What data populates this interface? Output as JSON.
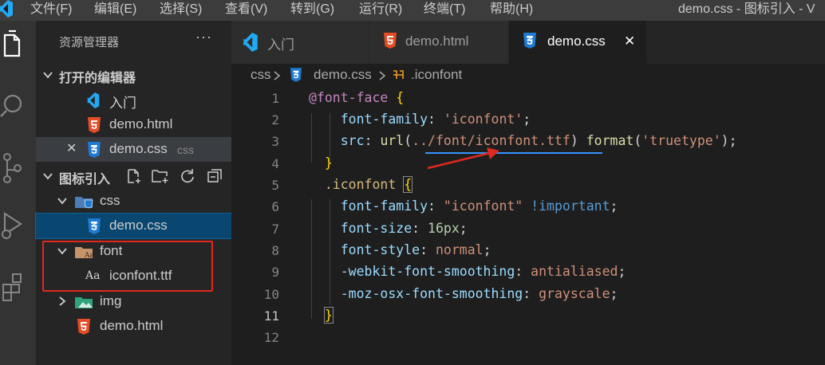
{
  "menubar": {
    "items": [
      "文件(F)",
      "编辑(E)",
      "选择(S)",
      "查看(V)",
      "转到(G)",
      "运行(R)",
      "终端(T)",
      "帮助(H)"
    ],
    "title": "demo.css - 图标引入 - V"
  },
  "sidebar": {
    "title": "资源管理器",
    "more": "···",
    "open_editors": {
      "label": "打开的编辑器",
      "items": [
        {
          "name": "入门"
        },
        {
          "name": "demo.html"
        },
        {
          "name": "demo.css",
          "desc": "css"
        }
      ]
    },
    "workspace": {
      "label": "图标引入",
      "tree": {
        "css_folder": "css",
        "css_file": "demo.css",
        "font_folder": "font",
        "font_file": "iconfont.ttf",
        "font_file_icon_text": "Aa",
        "img_folder": "img",
        "html_file": "demo.html"
      }
    }
  },
  "tabs": [
    {
      "label": "入门",
      "icon": "vscode-icon"
    },
    {
      "label": "demo.html",
      "icon": "html5-icon"
    },
    {
      "label": "demo.css",
      "icon": "css3-icon",
      "active": true,
      "close": "✕"
    }
  ],
  "breadcrumb": {
    "folder": "css",
    "file": "demo.css",
    "symbol": ".iconfont"
  },
  "editor": {
    "line_numbers": [
      "1",
      "2",
      "3",
      "4",
      "5",
      "6",
      "7",
      "8",
      "9",
      "10",
      "11",
      "12"
    ],
    "current_line": "11",
    "code": {
      "l1_at": "@font-face",
      "l1_brace": "{",
      "l2_prop": "font-family",
      "l2_val": "'iconfont'",
      "l3_prop": "src",
      "l3_fn": "url",
      "l3_link": "../font/iconfont.ttf",
      "l3_fn2": "format",
      "l3_val": "'truetype'",
      "l4_brace": "}",
      "l5_sel": ".iconfont",
      "l5_brace": "{",
      "l6_prop": "font-family",
      "l6_val": "\"iconfont\"",
      "l6_imp": "!important",
      "l7_prop": "font-size",
      "l7_val": "16px",
      "l8_prop": "font-style",
      "l8_val": "normal",
      "l9_prop": "-webkit-font-smoothing",
      "l9_val": "antialiased",
      "l10_prop": "-moz-osx-font-smoothing",
      "l10_val": "grayscale",
      "l11_brace": "}"
    }
  },
  "colors": {
    "annotation_red": "#e0281f",
    "active_file_bg": "#094771",
    "html_icon": "#e44d26",
    "css_icon": "#1f7ad1",
    "vscode_blue": "#23a9f2"
  }
}
